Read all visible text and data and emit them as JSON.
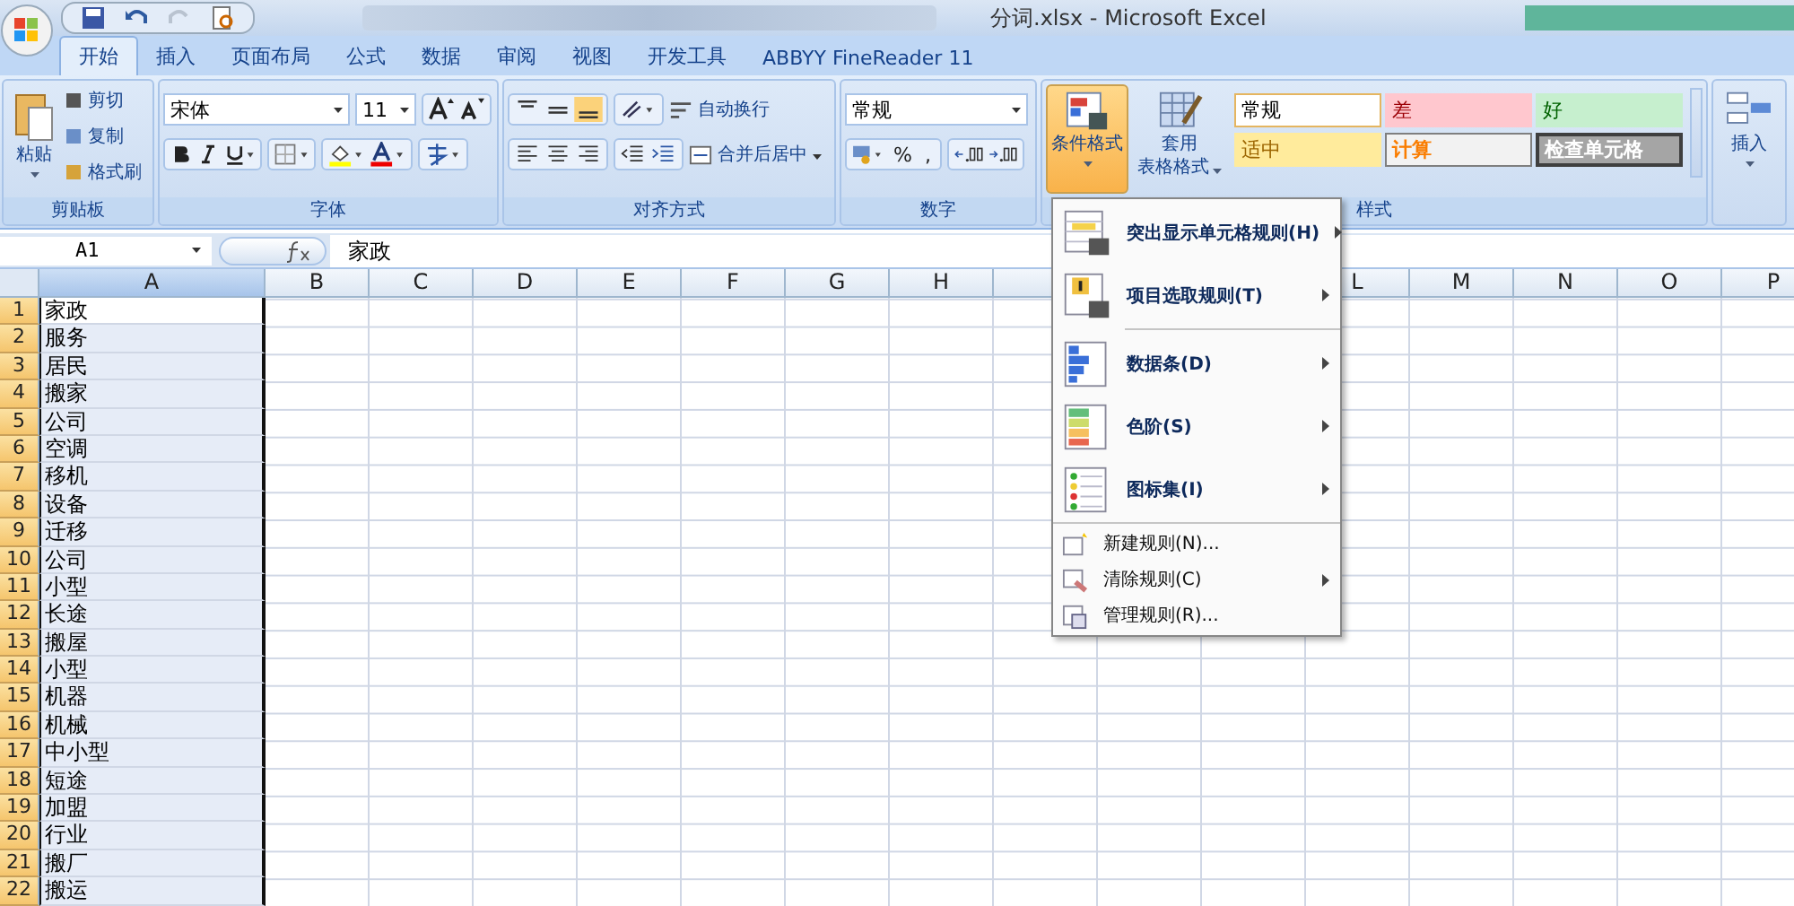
{
  "window": {
    "title": "分词.xlsx - Microsoft Excel"
  },
  "tabs": [
    {
      "label": "开始",
      "selected": true
    },
    {
      "label": "插入",
      "selected": false
    },
    {
      "label": "页面布局",
      "selected": false
    },
    {
      "label": "公式",
      "selected": false
    },
    {
      "label": "数据",
      "selected": false
    },
    {
      "label": "审阅",
      "selected": false
    },
    {
      "label": "视图",
      "selected": false
    },
    {
      "label": "开发工具",
      "selected": false
    },
    {
      "label": "ABBYY FineReader 11",
      "selected": false
    }
  ],
  "ribbon": {
    "clipboard": {
      "paste": "粘贴",
      "items": [
        "剪切",
        "复制",
        "格式刷"
      ],
      "group_label": "剪贴板"
    },
    "font": {
      "font_name": "宋体",
      "font_size": "11",
      "group_label": "字体"
    },
    "alignment": {
      "wrap": "自动换行",
      "merge": "合并后居中",
      "group_label": "对齐方式"
    },
    "number": {
      "format": "常规",
      "percent": "%",
      "comma": ",",
      "group_label": "数字"
    },
    "styles": {
      "conditional_format": {
        "label": "条件格式",
        "selected": true
      },
      "table_format": [
        "套用",
        "表格格式"
      ],
      "cell_styles": [
        {
          "label": "常规",
          "kind": "normal"
        },
        {
          "label": "差",
          "kind": "bad"
        },
        {
          "label": "好",
          "kind": "good"
        },
        {
          "label": "适中",
          "kind": "neutral"
        },
        {
          "label": "计算",
          "kind": "calc"
        },
        {
          "label": "检查单元格",
          "kind": "check"
        }
      ],
      "group_label": "样式"
    },
    "cells": {
      "insert": "插入"
    }
  },
  "formula_bar": {
    "name_box": "A1",
    "value": "家政"
  },
  "columns": [
    {
      "label": "A",
      "selected": true
    },
    {
      "label": "B",
      "selected": false
    },
    {
      "label": "C",
      "selected": false
    },
    {
      "label": "D",
      "selected": false
    },
    {
      "label": "E",
      "selected": false
    },
    {
      "label": "F",
      "selected": false
    },
    {
      "label": "G",
      "selected": false
    },
    {
      "label": "H",
      "selected": false
    }
  ],
  "columns_right": [
    {
      "label": "L",
      "selected": false
    },
    {
      "label": "M",
      "selected": false
    },
    {
      "label": "N",
      "selected": false
    },
    {
      "label": "O",
      "selected": false
    },
    {
      "label": "P",
      "selected": false
    }
  ],
  "rows": [
    {
      "number": "1",
      "value": "家政"
    },
    {
      "number": "2",
      "value": "服务"
    },
    {
      "number": "3",
      "value": "居民"
    },
    {
      "number": "4",
      "value": "搬家"
    },
    {
      "number": "5",
      "value": "公司"
    },
    {
      "number": "6",
      "value": "空调"
    },
    {
      "number": "7",
      "value": "移机"
    },
    {
      "number": "8",
      "value": "设备"
    },
    {
      "number": "9",
      "value": "迁移"
    },
    {
      "number": "10",
      "value": "公司"
    },
    {
      "number": "11",
      "value": "小型"
    },
    {
      "number": "12",
      "value": "长途"
    },
    {
      "number": "13",
      "value": "搬屋"
    },
    {
      "number": "14",
      "value": "小型"
    },
    {
      "number": "15",
      "value": "机器"
    },
    {
      "number": "16",
      "value": "机械"
    },
    {
      "number": "17",
      "value": "中小型"
    },
    {
      "number": "18",
      "value": "短途"
    },
    {
      "number": "19",
      "value": "加盟"
    },
    {
      "number": "20",
      "value": "行业"
    },
    {
      "number": "21",
      "value": "搬厂"
    },
    {
      "number": "22",
      "value": "搬运"
    }
  ],
  "menu": [
    {
      "label": "突出显示单元格规则(H)",
      "kind": "highlight",
      "submenu": true
    },
    {
      "label": "项目选取规则(T)",
      "kind": "top",
      "submenu": true
    },
    {
      "label": "数据条(D)",
      "kind": "databar",
      "submenu": true
    },
    {
      "label": "色阶(S)",
      "kind": "scale",
      "submenu": true
    },
    {
      "label": "图标集(I)",
      "kind": "iconset",
      "submenu": true
    },
    {
      "label": "新建规则(N)...",
      "kind": "new",
      "submenu": false
    },
    {
      "label": "清除规则(C)",
      "kind": "clear",
      "submenu": true
    },
    {
      "label": "管理规则(R)...",
      "kind": "manage",
      "submenu": false
    }
  ]
}
